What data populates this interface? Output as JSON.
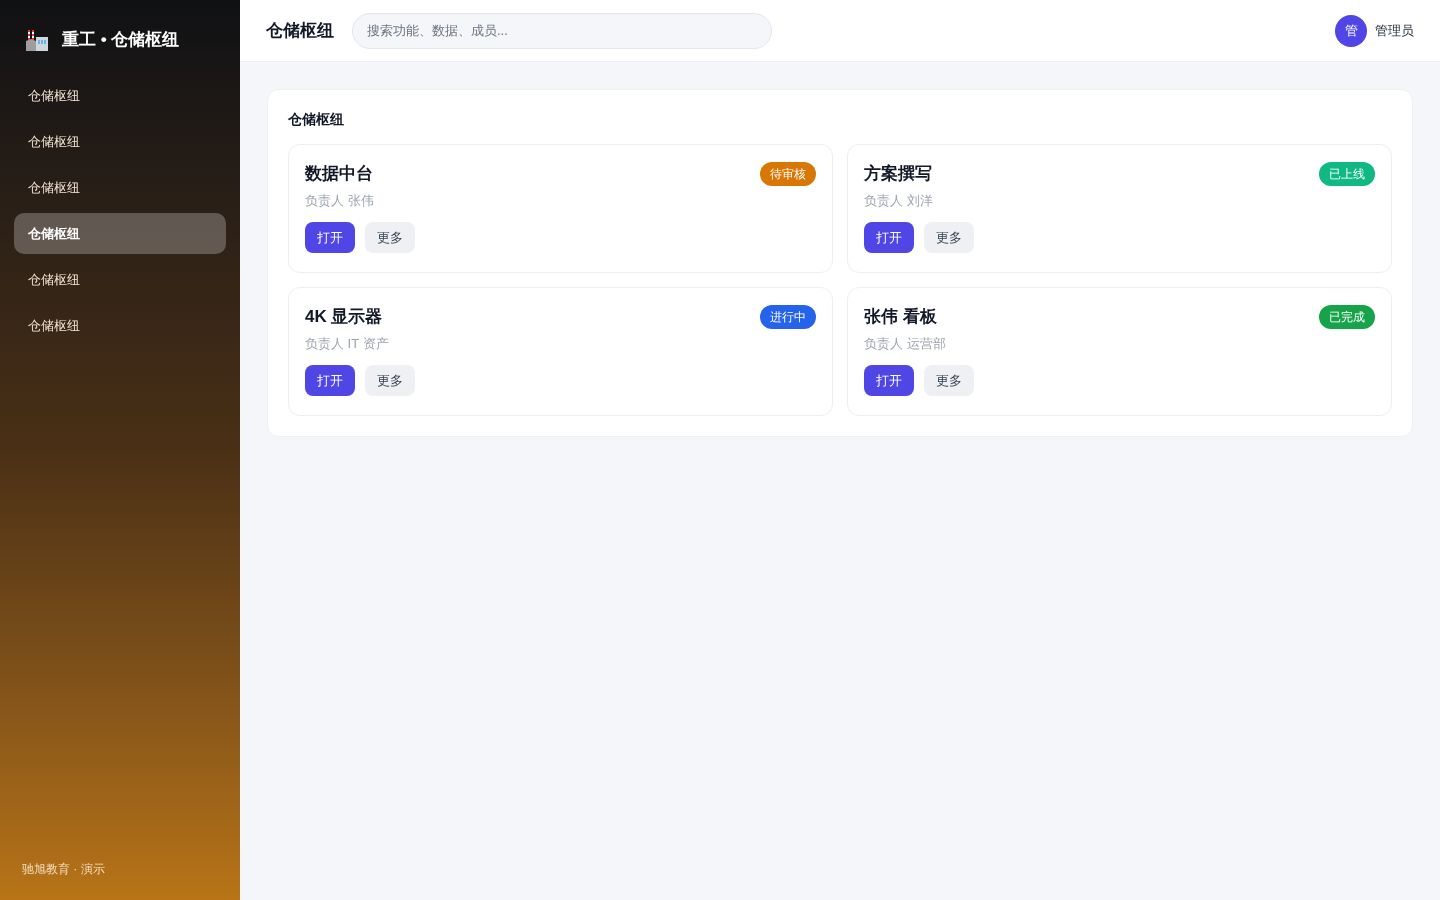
{
  "sidebar": {
    "brand": "重工 • 仓储枢纽",
    "items": [
      {
        "label": "仓储枢纽",
        "selected": false
      },
      {
        "label": "仓储枢纽",
        "selected": false
      },
      {
        "label": "仓储枢纽",
        "selected": false
      },
      {
        "label": "仓储枢纽",
        "selected": true
      },
      {
        "label": "仓储枢纽",
        "selected": false
      },
      {
        "label": "仓储枢纽",
        "selected": false
      }
    ],
    "footer": "驰旭教育 · 演示"
  },
  "header": {
    "title": "仓储枢纽",
    "search": {
      "placeholder": "搜索功能、数据、成员..."
    },
    "user": {
      "avatar": "管",
      "name": "管理员"
    }
  },
  "panel": {
    "title": "仓储枢纽",
    "cards": [
      {
        "title": "数据中台",
        "status": {
          "label": "待审核",
          "color": "#d97706"
        },
        "owner": "负责人 张伟",
        "actions": [
          {
            "label": "打开",
            "kind": "primary"
          },
          {
            "label": "更多",
            "kind": "secondary"
          }
        ]
      },
      {
        "title": "方案撰写",
        "status": {
          "label": "已上线",
          "color": "#10b981"
        },
        "owner": "负责人 刘洋",
        "actions": [
          {
            "label": "打开",
            "kind": "primary"
          },
          {
            "label": "更多",
            "kind": "secondary"
          }
        ]
      },
      {
        "title": "4K 显示器",
        "status": {
          "label": "进行中",
          "color": "#2563eb"
        },
        "owner": "负责人 IT 资产",
        "actions": [
          {
            "label": "打开",
            "kind": "primary"
          },
          {
            "label": "更多",
            "kind": "secondary"
          }
        ]
      },
      {
        "title": "张伟 看板",
        "status": {
          "label": "已完成",
          "color": "#16a34a"
        },
        "owner": "负责人 运营部",
        "actions": [
          {
            "label": "打开",
            "kind": "primary"
          },
          {
            "label": "更多",
            "kind": "secondary"
          }
        ]
      }
    ]
  }
}
